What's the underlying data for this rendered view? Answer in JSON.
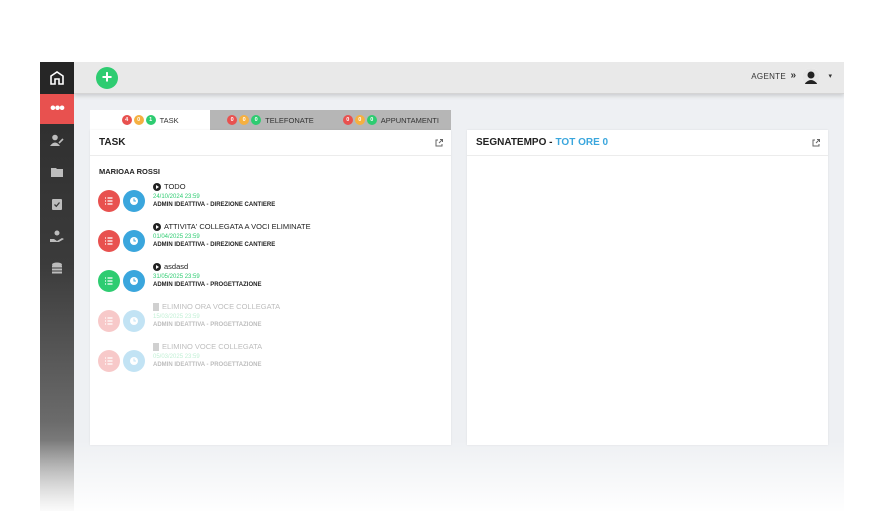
{
  "header": {
    "agent_label": "AGENTE",
    "agent_arrow": "»",
    "caret": "▾",
    "add_symbol": "+"
  },
  "sidebar": {
    "active_symbol": "•••",
    "icons": [
      "home-logo-icon",
      "more-icon",
      "user-edit-icon",
      "folder-icon",
      "clipboard-check-icon",
      "hand-user-icon",
      "coins-icon"
    ]
  },
  "tabs": [
    {
      "label": "TASK",
      "counts": [
        "4",
        "0",
        "1"
      ]
    },
    {
      "label": "TELEFONATE",
      "counts": [
        "0",
        "0",
        "0"
      ]
    },
    {
      "label": "APPUNTAMENTI",
      "counts": [
        "0",
        "0",
        "0"
      ]
    }
  ],
  "task_panel": {
    "title": "TASK",
    "owner": "MARIOAA ROSSI",
    "tasks": [
      {
        "title": "TODO",
        "date": "24/10/2024 23:59",
        "admin": "ADMIN IDEATTIVA - DIREZIONE CANTIERE"
      },
      {
        "title": "ATTIVITA' COLLEGATA A VOCI ELIMINATE",
        "date": "01/04/2025 23:59",
        "admin": "ADMIN IDEATTIVA - DIREZIONE CANTIERE"
      },
      {
        "title": "asdasd",
        "date": "31/05/2025 23:59",
        "admin": "ADMIN IDEATTIVA - PROGETTAZIONE"
      },
      {
        "title": "ELIMINO ORA VOCE COLLEGATA",
        "date": "15/03/2025 23:59",
        "admin": "ADMIN IDEATTIVA - PROGETTAZIONE"
      },
      {
        "title": "ELIMINO VOCE COLLEGATA",
        "date": "05/03/2025 23:59",
        "admin": "ADMIN IDEATTIVA - PROGETTAZIONE"
      }
    ]
  },
  "segnatempo_panel": {
    "title": "SEGNATEMPO -",
    "total": "TOT ORE 0"
  },
  "colors": {
    "red": "#e8514f",
    "blue": "#3aa6dd",
    "green": "#2ecc71",
    "yellow": "#f5b041"
  }
}
